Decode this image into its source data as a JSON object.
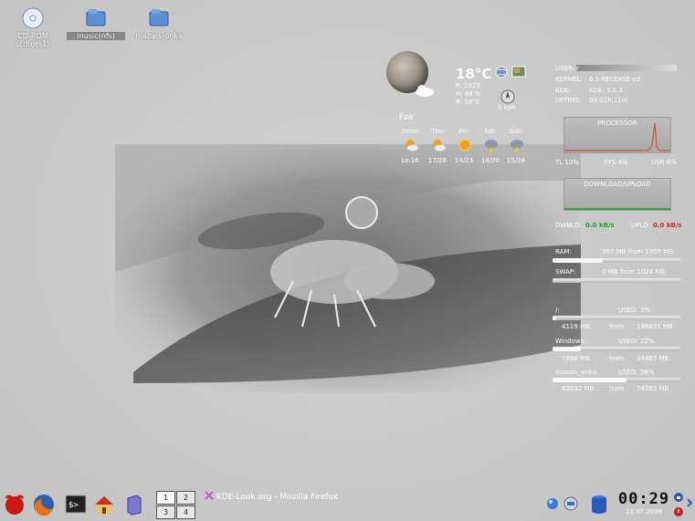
{
  "desktop": {
    "icons": [
      {
        "label": "CD-ROM\n(cdrom1)"
      },
      {
        "label": "music(nfs)"
      },
      {
        "label": "mazais_onka"
      }
    ]
  },
  "weather": {
    "temp": "18°C",
    "pressure": "P: 1023",
    "humidity": "H: 68 %",
    "realfeel": "R: 18°C",
    "wind": "5 kph",
    "condition": "Fair",
    "forecast": [
      {
        "day": "2nite:",
        "temps": "Lo:16"
      },
      {
        "day": "Thu:",
        "temps": "17/26"
      },
      {
        "day": "Fri:",
        "temps": "14/23"
      },
      {
        "day": "Sat:",
        "temps": "14/20"
      },
      {
        "day": "Sun:",
        "temps": "15/24"
      }
    ]
  },
  "sysinfo": {
    "user_label": "USER:",
    "user_value": "r",
    "kernel_label": "KERNEL:",
    "kernel_value": "6.1-RELEASE-p2",
    "kde_label": "KDE:",
    "kde_value": "KDE: 3.5.3",
    "uptime_label": "UPTIME:",
    "uptime_value": "0d  01h:11m",
    "processor_title": "PROCESSOR",
    "tl": "TL 10%",
    "sys": "SYS 4%",
    "usr": "USR 6%",
    "download_title": "DOWNLOAD/UPLOAD",
    "dwnld_label": "DWNLD:",
    "dwnld_value": "0.0 kB/s",
    "upld_label": "UPLD:",
    "upld_value": "0.0 kB/s",
    "ram_label": "RAM:",
    "ram_value": "397 MB from 1007 MB",
    "ram_frac": 0.39,
    "swap_label": "SWAP:",
    "swap_value": "0 MB from 1024 MB",
    "swap_frac": 0.0,
    "disks": [
      {
        "name": "/:",
        "used": "USED: 3%",
        "a": "4119 MB",
        "from": "from",
        "b": "146831 MB",
        "frac": 0.03
      },
      {
        "name": "Windows:",
        "used": "USED: 22%",
        "a": "7698 MB",
        "from": "from",
        "b": "34467 MB",
        "frac": 0.22
      },
      {
        "name": "mazais_onka:",
        "used": "USED: 58%",
        "a": "43532 MB",
        "from": "from",
        "b": "74765 MB",
        "frac": 0.58
      }
    ]
  },
  "taskbar": {
    "pager": [
      "1",
      "2",
      "3",
      "4"
    ],
    "task_title": "KDE-Look.org - Mozilla Firefox",
    "clock_time": "00:29",
    "clock_date": "13.07.2006"
  }
}
